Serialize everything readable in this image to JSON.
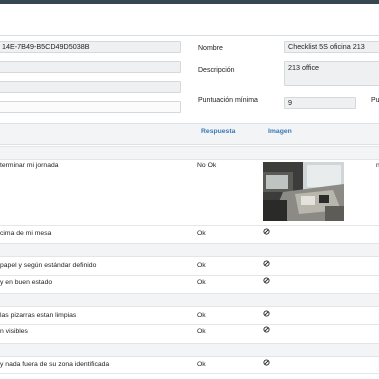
{
  "header": {
    "id_value": "14E-7B49-B5CD49D5038B",
    "nombre_label": "Nombre",
    "nombre_value": "Checklist 5S oficina 213",
    "descripcion_label": "Descripción",
    "descripcion_value": "213 office",
    "puntuacion_label": "Puntuación mínima",
    "puntuacion_value": "9",
    "right_cut_label": "Pu"
  },
  "table": {
    "columns": {
      "respuesta": "Respuesta",
      "imagen": "Imagen"
    },
    "rows": [
      {
        "text": "terminar mi jornada",
        "answer": "No Ok",
        "image": "photo",
        "extra": "n"
      },
      {
        "text": "cima de mi mesa",
        "answer": "Ok",
        "image": "none-icon"
      },
      {
        "text": "papel y según estándar definido",
        "answer": "Ok",
        "image": "none-icon"
      },
      {
        "text": "y en buen estado",
        "answer": "Ok",
        "image": "none-icon"
      },
      {
        "text": "las pizarras estan limpias",
        "answer": "Ok",
        "image": "none-icon"
      },
      {
        "text": "n visibles",
        "answer": "Ok",
        "image": "none-icon"
      },
      {
        "text": "y nada fuera de su zona identificada",
        "answer": "Ok",
        "image": "none-icon"
      }
    ]
  }
}
